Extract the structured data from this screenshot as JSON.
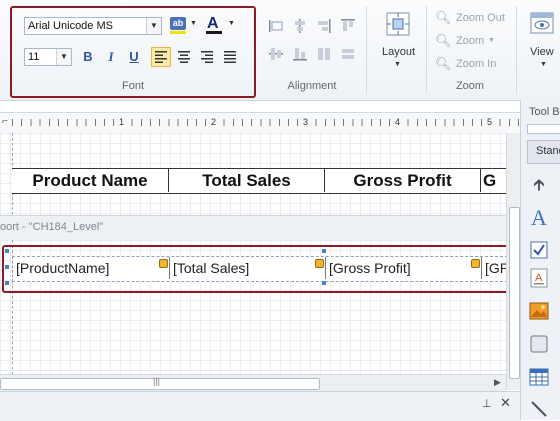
{
  "font_group": {
    "font_name": "Arial Unicode MS",
    "font_size": "11",
    "label": "Font",
    "highlight_glyph": "ab",
    "font_color_glyph": "A",
    "bold": "B",
    "italic": "I",
    "underline": "U"
  },
  "alignment_group": {
    "label": "Alignment"
  },
  "layout_button": {
    "label": "Layout"
  },
  "zoom_group": {
    "label": "Zoom",
    "zoom_out": "Zoom Out",
    "zoom": "Zoom",
    "zoom_in": "Zoom In"
  },
  "view_button": {
    "label": "View"
  },
  "ruler": {
    "marks": [
      "1",
      "2",
      "3",
      "4",
      "5"
    ]
  },
  "report": {
    "headers": [
      "Product Name",
      "Total Sales",
      "Gross Profit",
      "G"
    ],
    "group_band_label": "oort - \"CH184_Level\"",
    "detail_fields": [
      "[ProductName]",
      "[Total Sales]",
      "[Gross Profit]",
      "[GP"
    ]
  },
  "toolbox": {
    "title": "Tool B",
    "tab": "Standa",
    "tools": [
      "pointer-tool",
      "label-tool",
      "checkbox-tool",
      "textbox-tool",
      "picture-tool",
      "shape-tool",
      "table-tool",
      "line-tool"
    ]
  },
  "colors": {
    "highlight_border": "#8b1a22",
    "accent": "#2f56a8"
  }
}
